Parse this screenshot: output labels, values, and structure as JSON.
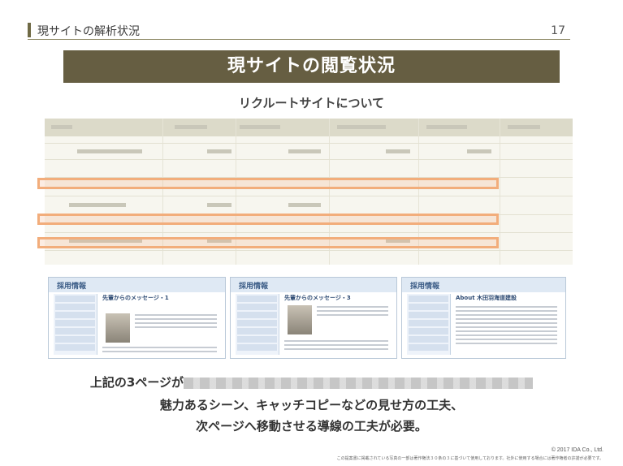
{
  "header": {
    "section_title": "現サイトの解析状況",
    "page_number": "17"
  },
  "banner": {
    "title": "現サイトの閲覧状況"
  },
  "subtitle": "リクルートサイトについて",
  "thumbnails": [
    {
      "heading": "採用情報",
      "message": "先輩からのメッセージ・1"
    },
    {
      "heading": "採用情報",
      "message": "先輩からのメッセージ・3"
    },
    {
      "heading": "採用情報",
      "message": "About 木田羽海道建設"
    }
  ],
  "body": {
    "line1_prefix": "上記の3ページが",
    "line2": "魅力あるシーン、キャッチコピーなどの見せ方の工夫、",
    "line3": "次ページへ移動させる導線の工夫が必要。"
  },
  "footer": {
    "copyright": "© 2017 IDA Co., Ltd.",
    "notice": "この提案書に掲載されている写真の一部は著作権法３０条の３に基づいて使用しております。社外に使用する場合には著作権者の許諾が必要です。"
  },
  "colors": {
    "banner_bg": "#665e42",
    "highlight": "#f2ad7b",
    "accent_rule": "#8a8560"
  }
}
